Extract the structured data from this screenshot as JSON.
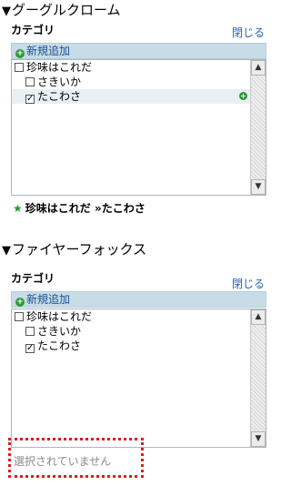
{
  "chrome": {
    "title": "グーグルクローム",
    "panel_heading": "カテゴリ",
    "close_label": "閉じる",
    "add_new_label": "新規追加",
    "items": [
      {
        "label": "珍味はこれだ",
        "checked": false
      },
      {
        "label": "さきいか",
        "checked": false
      },
      {
        "label": "たこわさ",
        "checked": true
      }
    ],
    "breadcrumb": {
      "parent": "珍味はこれだ",
      "separator": "»",
      "current": "たこわさ"
    }
  },
  "firefox": {
    "title": "ファイヤーフォックス",
    "panel_heading": "カテゴリ",
    "close_label": "閉じる",
    "add_new_label": "新規追加",
    "items": [
      {
        "label": "珍味はこれだ",
        "checked": false
      },
      {
        "label": "さきいか",
        "checked": false
      },
      {
        "label": "たこわさ",
        "checked": true
      }
    ],
    "status_text": "選択されていません"
  },
  "colors": {
    "accent_green": "#2c9a3a",
    "header_bar": "#c7dce6",
    "highlight_border": "#e21a1a",
    "link": "#2a62b8"
  },
  "icons": {
    "title_marker": "▼",
    "plus": "+",
    "star": "★",
    "scroll_up": "▲",
    "scroll_down": "▼",
    "check": "✓"
  }
}
